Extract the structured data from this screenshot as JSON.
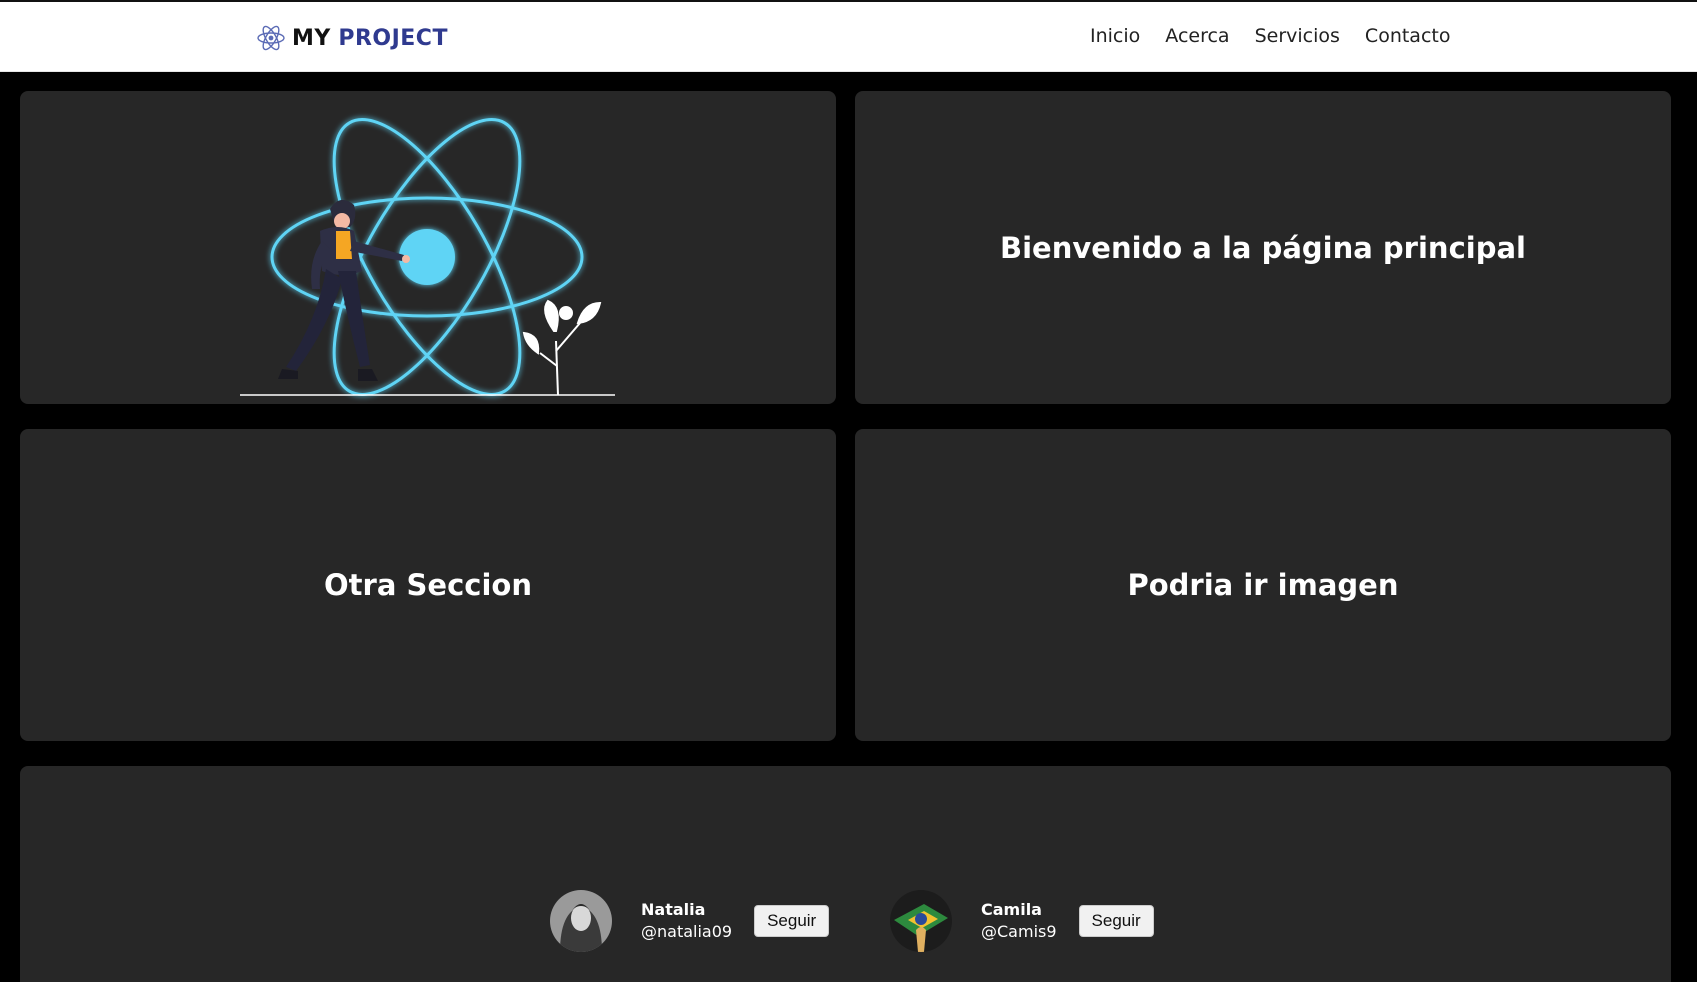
{
  "navbar": {
    "brand_my": "MY",
    "brand_project": "PROJECT",
    "links": [
      "Inicio",
      "Acerca",
      "Servicios",
      "Contacto"
    ]
  },
  "cards": {
    "welcome": "Bienvenido a la página principal",
    "other": "Otra Seccion",
    "image": "Podria ir imagen"
  },
  "users": [
    {
      "name": "Natalia",
      "handle": "@natalia09",
      "button": "Seguir"
    },
    {
      "name": "Camila",
      "handle": "@Camis9",
      "button": "Seguir"
    }
  ],
  "colors": {
    "background": "#000000",
    "card": "#272727",
    "accent": "#5fd4f5",
    "brand": "#2f3a8f"
  },
  "icons": {
    "logo": "atom-icon"
  }
}
